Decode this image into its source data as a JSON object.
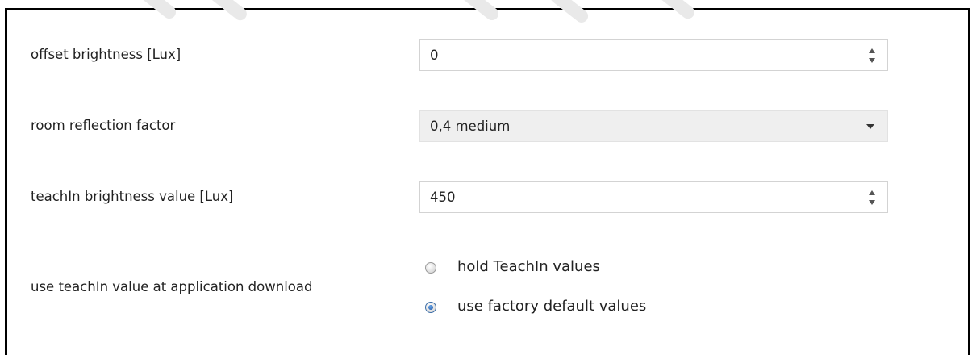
{
  "offset_brightness": {
    "label": "offset brightness [Lux]",
    "value": "0"
  },
  "room_reflection": {
    "label": "room reflection factor",
    "selected": "0,4 medium"
  },
  "teachin_brightness": {
    "label": "teachIn brightness value [Lux]",
    "value": "450"
  },
  "teachin_download": {
    "label": "use teachIn value at application download",
    "options": [
      {
        "label": "hold TeachIn values",
        "checked": false
      },
      {
        "label": "use factory default values",
        "checked": true
      }
    ]
  },
  "colors": {
    "accent": "#2a62b0",
    "panel_border": "#000000",
    "field_border": "#d3d3d3",
    "select_bg": "#efefef"
  }
}
